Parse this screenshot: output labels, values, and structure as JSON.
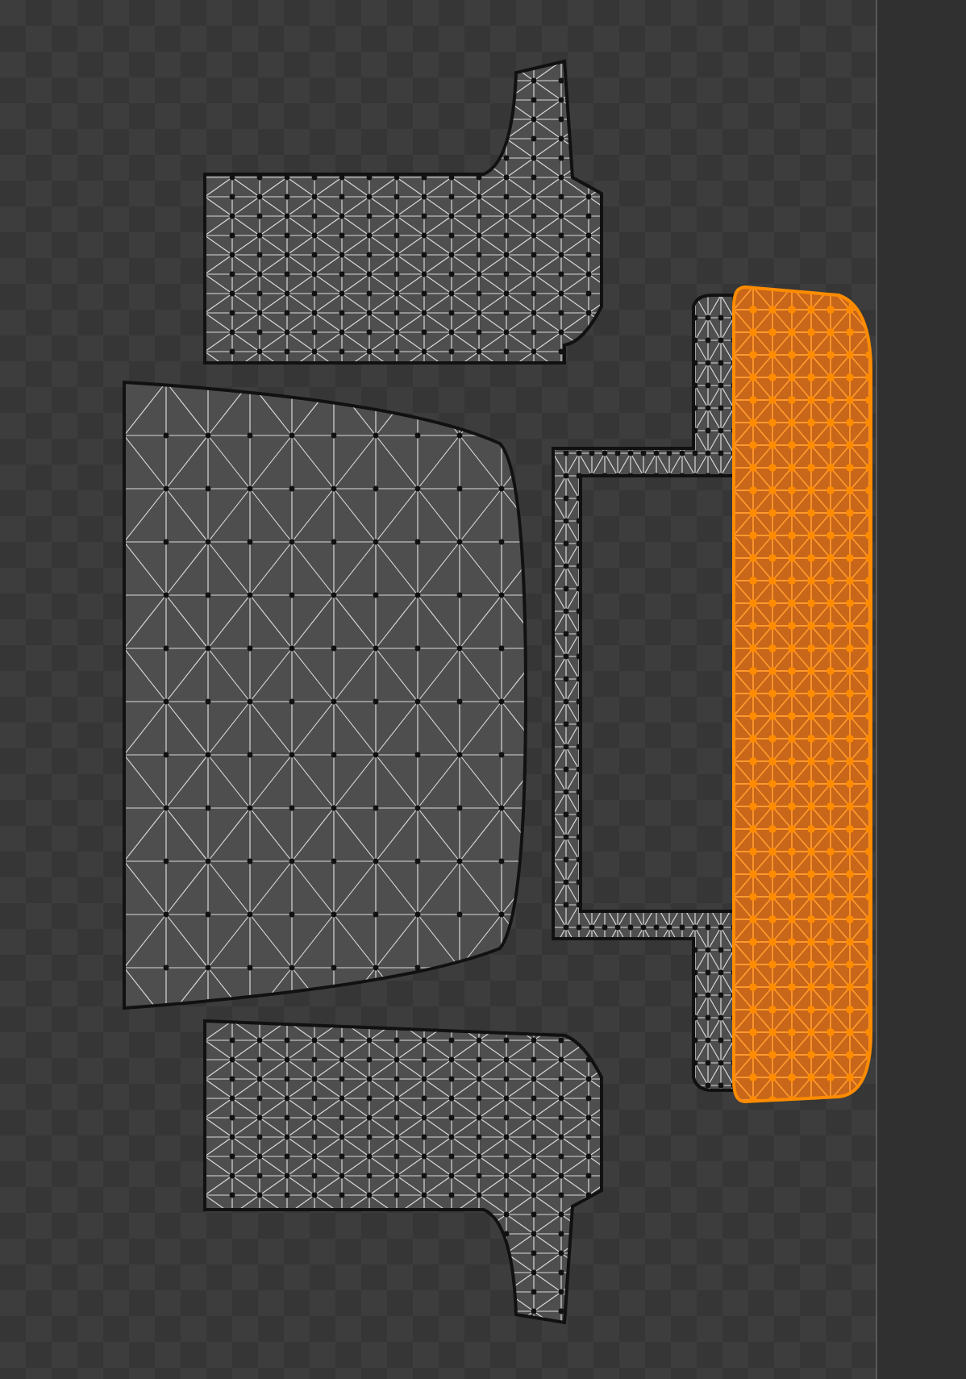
{
  "uv_islands": [
    {
      "selected": false
    },
    {
      "selected": false
    },
    {
      "selected": false
    },
    {
      "selected": false
    },
    {
      "selected": true
    }
  ]
}
